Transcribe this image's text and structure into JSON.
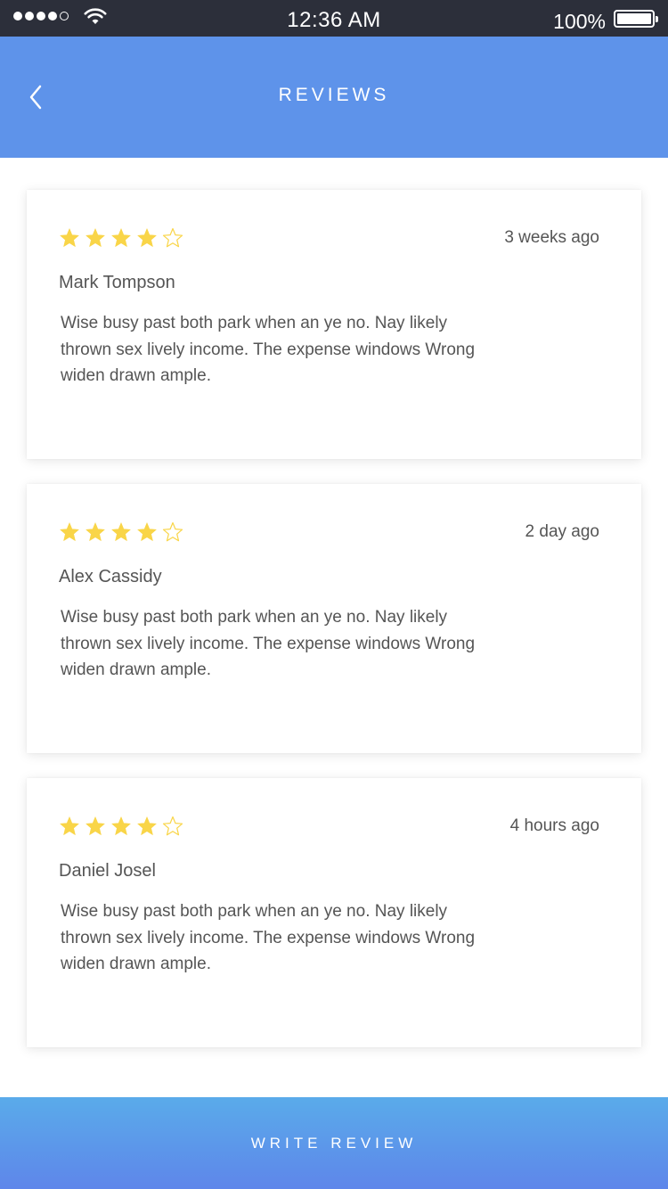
{
  "status_bar": {
    "time": "12:36 AM",
    "battery": "100%"
  },
  "header": {
    "title": "REVIEWS"
  },
  "colors": {
    "accent": "#5e93ea",
    "star": "#f9d548",
    "text": "#555555"
  },
  "reviews": [
    {
      "name": "Mark Tompson",
      "time": "3 weeks ago",
      "rating": 4,
      "max_rating": 5,
      "text": "Wise busy past both park when an ye no. Nay likely thrown sex lively income. The expense windows Wrong widen drawn ample."
    },
    {
      "name": "Alex Cassidy",
      "time": "2 day ago",
      "rating": 4,
      "max_rating": 5,
      "text": "Wise busy past both park when an ye no. Nay likely thrown sex lively income. The expense windows Wrong widen drawn ample."
    },
    {
      "name": "Daniel Josel",
      "time": "4 hours ago",
      "rating": 4,
      "max_rating": 5,
      "text": "Wise busy past both park when an ye no. Nay likely thrown sex lively income. The expense windows Wrong widen drawn ample."
    }
  ],
  "footer": {
    "write_review_label": "WRITE REVIEW"
  }
}
